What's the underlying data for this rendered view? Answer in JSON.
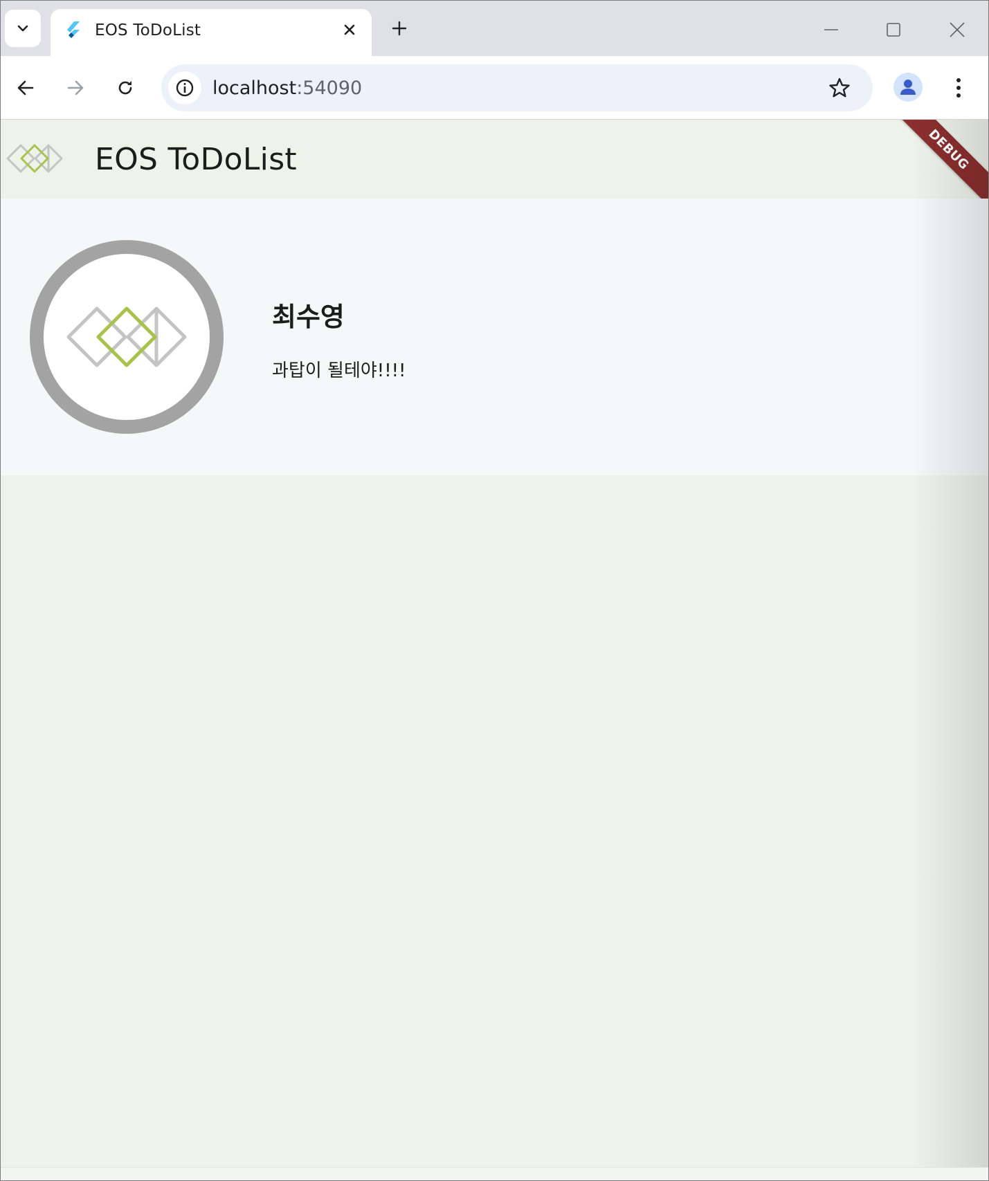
{
  "browser": {
    "tab": {
      "title": "EOS ToDoList",
      "favicon": "flutter-icon"
    },
    "address_bar": {
      "host": "localhost",
      "port": ":54090"
    },
    "icons": {
      "tab_search": "chevron-down-icon",
      "tab_close": "close-icon",
      "new_tab": "plus-icon",
      "minimize": "minimize-icon",
      "maximize": "maximize-icon",
      "close_window": "close-icon",
      "back": "arrow-left-icon",
      "forward": "arrow-right-icon",
      "reload": "reload-icon",
      "site_info": "info-icon",
      "bookmark": "star-icon",
      "profile": "person-icon",
      "menu": "more-vert-icon"
    }
  },
  "app": {
    "title": "EOS ToDoList",
    "debug_banner": "DEBUG",
    "profile": {
      "name": "최수영",
      "status_message": "과탑이 될테야!!!!"
    }
  },
  "colors": {
    "app_background": "#eef3ea",
    "profile_card": "#f4f8f8",
    "avatar_ring": "#a3a3a3",
    "logo_green": "#a8c34d",
    "logo_gray": "#c4c4c4",
    "debug_banner": "#8b2f2f",
    "profile_icon_bg": "#d3e3fd",
    "profile_icon_fg": "#3a5bc7"
  }
}
